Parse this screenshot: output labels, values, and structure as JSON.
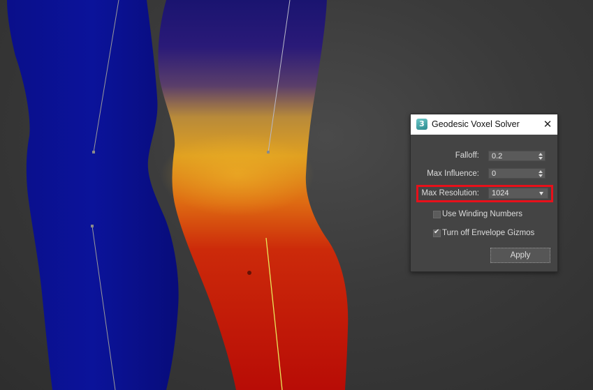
{
  "dialog": {
    "title": "Geodesic Voxel Solver",
    "app_icon_glyph": "3",
    "close_glyph": "✕",
    "fields": {
      "falloff": {
        "label": "Falloff:",
        "value": "0.2"
      },
      "max_influence": {
        "label": "Max Influence:",
        "value": "0"
      },
      "max_resolution": {
        "label": "Max Resolution:",
        "value": "1024"
      }
    },
    "checkboxes": {
      "use_winding_numbers": {
        "label": "Use Winding Numbers",
        "checked": false
      },
      "turn_off_envelope_gizmos": {
        "label": "Turn off Envelope Gizmos",
        "checked": true
      }
    },
    "apply_label": "Apply"
  },
  "colors": {
    "viewport_background": "#3a3a3a",
    "weight_zero": "#0b0f8f",
    "weight_mid": "#e8a41a",
    "weight_full": "#c8100a",
    "highlight": "#e8101a",
    "active_bone": "#e8e85a"
  },
  "icons": [
    "3ds-max-app-icon",
    "close-icon",
    "spinner-arrows-icon",
    "dropdown-arrow-icon",
    "checkmark-icon"
  ]
}
